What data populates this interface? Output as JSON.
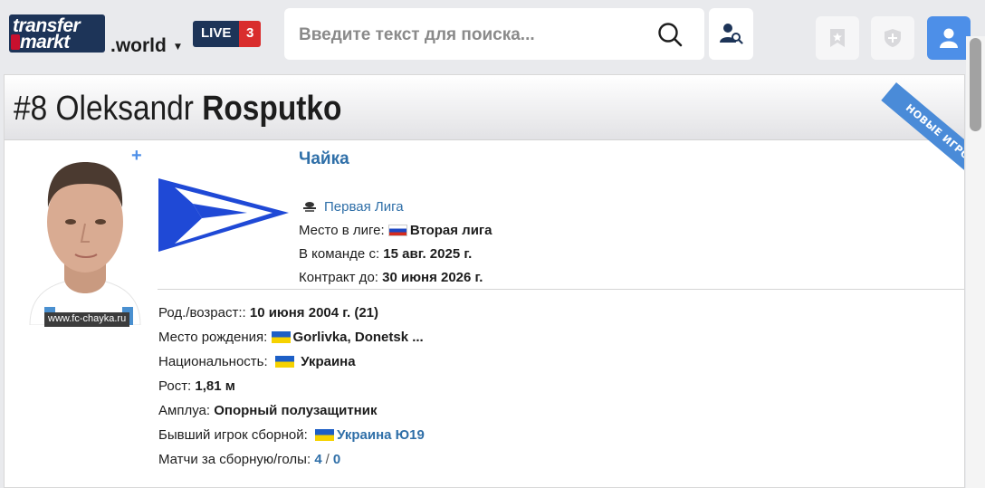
{
  "header": {
    "logo_line1": "transfer",
    "logo_line2": "markt",
    "site_suffix": ".world",
    "live_label": "LIVE",
    "live_count": "3",
    "search_placeholder": "Введите текст для поиска...",
    "icons": [
      "search-icon",
      "user-search-icon",
      "bookmark-icon",
      "shield-plus-icon",
      "profile-icon"
    ]
  },
  "player": {
    "number": "#8",
    "first_name": "Oleksandr",
    "last_name": "Rosputko",
    "ribbon": "НОВЫЕ ИГРОКИ",
    "photo_credit": "www.fc-chayka.ru",
    "plus": "+"
  },
  "club": {
    "name": "Чайка",
    "league_link": "Первая Лига",
    "league_place_label": "Место в лиге:",
    "league_place_value": "Вторая лига",
    "joined_label": "В команде с:",
    "joined_value": "15 авг. 2025 г.",
    "contract_label": "Контракт до:",
    "contract_value": "30 июня 2026 г."
  },
  "details": {
    "birth_label": "Род./возраст::",
    "birth_value": "10 июня 2004 г. (21)",
    "birthplace_label": "Место рождения:",
    "birthplace_value": "Gorlivka, Donetsk ...",
    "nationality_label": "Национальность:",
    "nationality_value": "Украина",
    "height_label": "Рост:",
    "height_value": "1,81 м",
    "position_label": "Амплуа:",
    "position_value": "Опорный полузащитник",
    "former_intl_label": "Бывший игрок сборной:",
    "former_intl_value": "Украина Ю19",
    "caps_label": "Матчи за сборную/голы:",
    "caps_value": "4",
    "caps_sep": "/",
    "goals_value": "0"
  },
  "colors": {
    "brand_navy": "#1d3458",
    "live_red": "#d92d2d",
    "link_blue": "#2f6fa8",
    "accent_blue": "#4d8fe8"
  }
}
